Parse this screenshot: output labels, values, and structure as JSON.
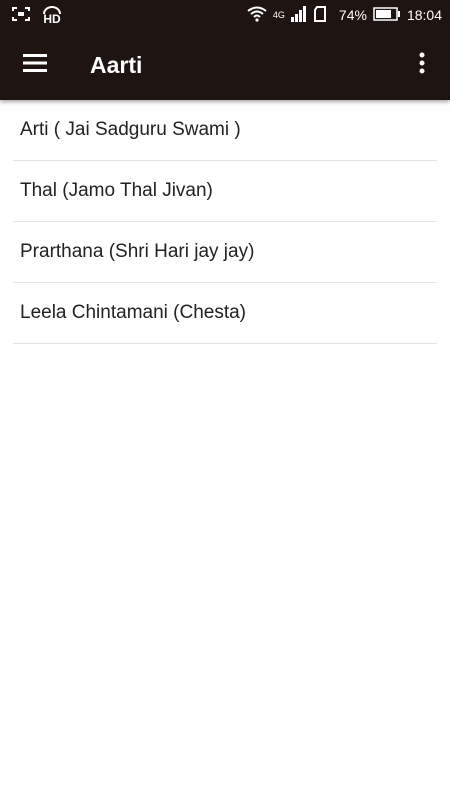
{
  "status_bar": {
    "battery": "74%",
    "time": "18:04",
    "network": "4G",
    "hd_label": "HD"
  },
  "app_bar": {
    "title": "Aarti",
    "menu_icon": "hamburger-menu-icon",
    "overflow_icon": "more-vert-icon"
  },
  "colors": {
    "app_bar_bg": "#1e1512",
    "text": "#222222",
    "divider": "#e4e4e4"
  },
  "items": [
    {
      "label": "Arti ( Jai Sadguru Swami )"
    },
    {
      "label": "Thal (Jamo Thal Jivan)"
    },
    {
      "label": "Prarthana (Shri Hari jay jay)"
    },
    {
      "label": "Leela Chintamani (Chesta)"
    }
  ]
}
